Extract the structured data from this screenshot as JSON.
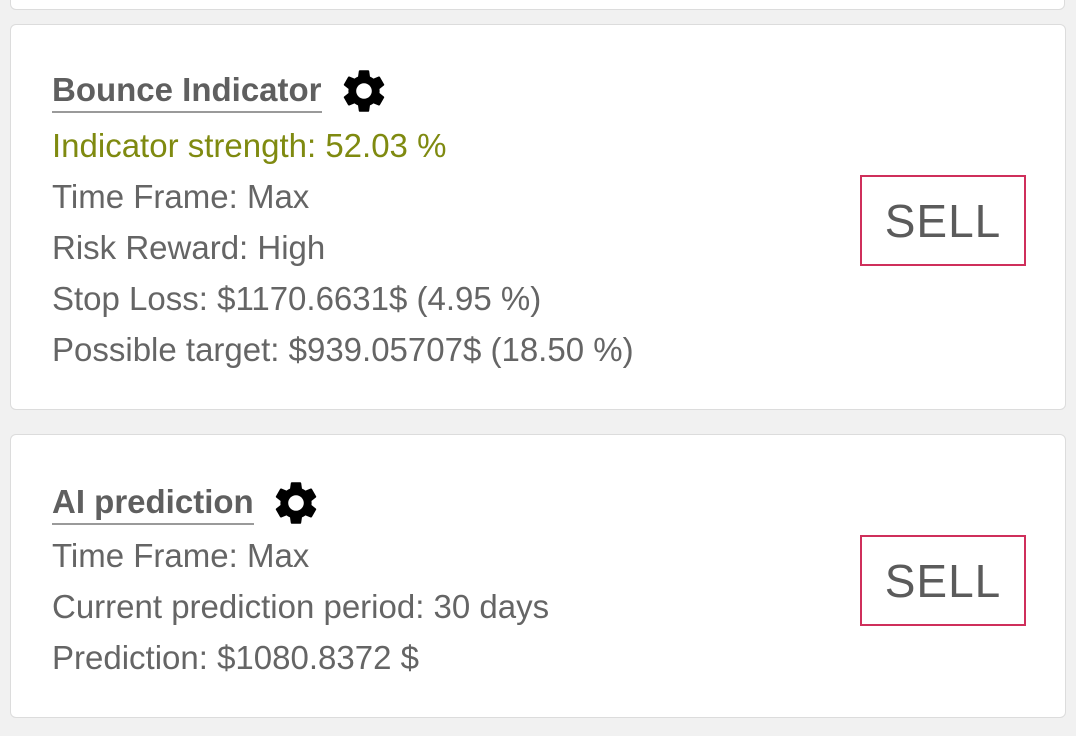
{
  "colors": {
    "strength_text": "#7f8a10",
    "signal_border": "#cf2f5b",
    "body_text": "#656565",
    "title_text": "#5f5f5f"
  },
  "bounce": {
    "title": "Bounce Indicator",
    "settings_icon": "gear-icon",
    "strength": "Indicator strength: 52.03 %",
    "time_frame": "Time Frame: Max",
    "risk_reward": "Risk Reward: High",
    "stop_loss": "Stop Loss: $1170.6631$ (4.95 %)",
    "possible_target": "Possible target: $939.05707$ (18.50 %)",
    "signal": "SELL"
  },
  "ai": {
    "title": "AI prediction",
    "settings_icon": "gear-icon",
    "time_frame": "Time Frame: Max",
    "prediction_period": "Current prediction period: 30 days",
    "prediction": "Prediction: $1080.8372 $",
    "signal": "SELL"
  }
}
